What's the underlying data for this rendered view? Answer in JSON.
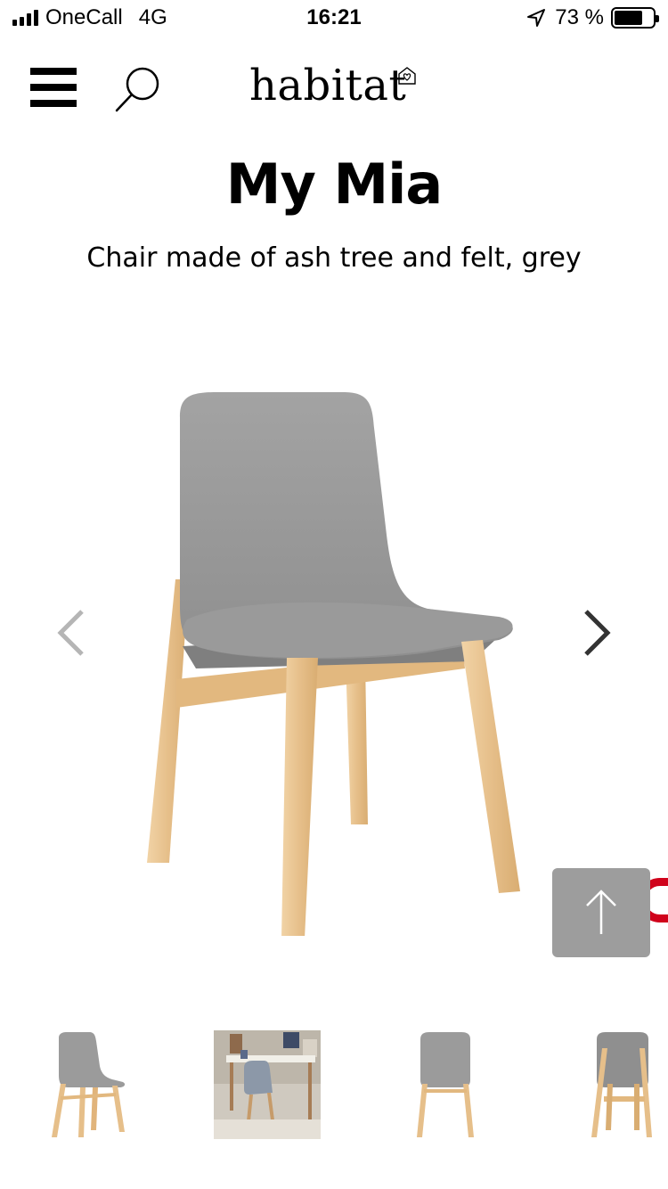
{
  "status_bar": {
    "carrier": "OneCall",
    "network": "4G",
    "time": "16:21",
    "battery_text": "73 %",
    "battery_level": 0.73
  },
  "header": {
    "logo": "habitat",
    "icons": [
      "menu-icon",
      "search-icon",
      "house-heart-icon"
    ]
  },
  "product": {
    "name": "My Mia",
    "description": "Chair made of ash tree and felt, grey"
  },
  "carousel": {
    "current_image": "chair-front-three-quarter",
    "thumbnails": [
      "chair-side",
      "chair-in-room",
      "chair-front",
      "chair-back"
    ]
  },
  "colors": {
    "felt_grey": "#9e9e9e",
    "ash_wood": "#e8c594",
    "scroll_button": "#9d9d9d",
    "accent_red": "#d0021b"
  }
}
